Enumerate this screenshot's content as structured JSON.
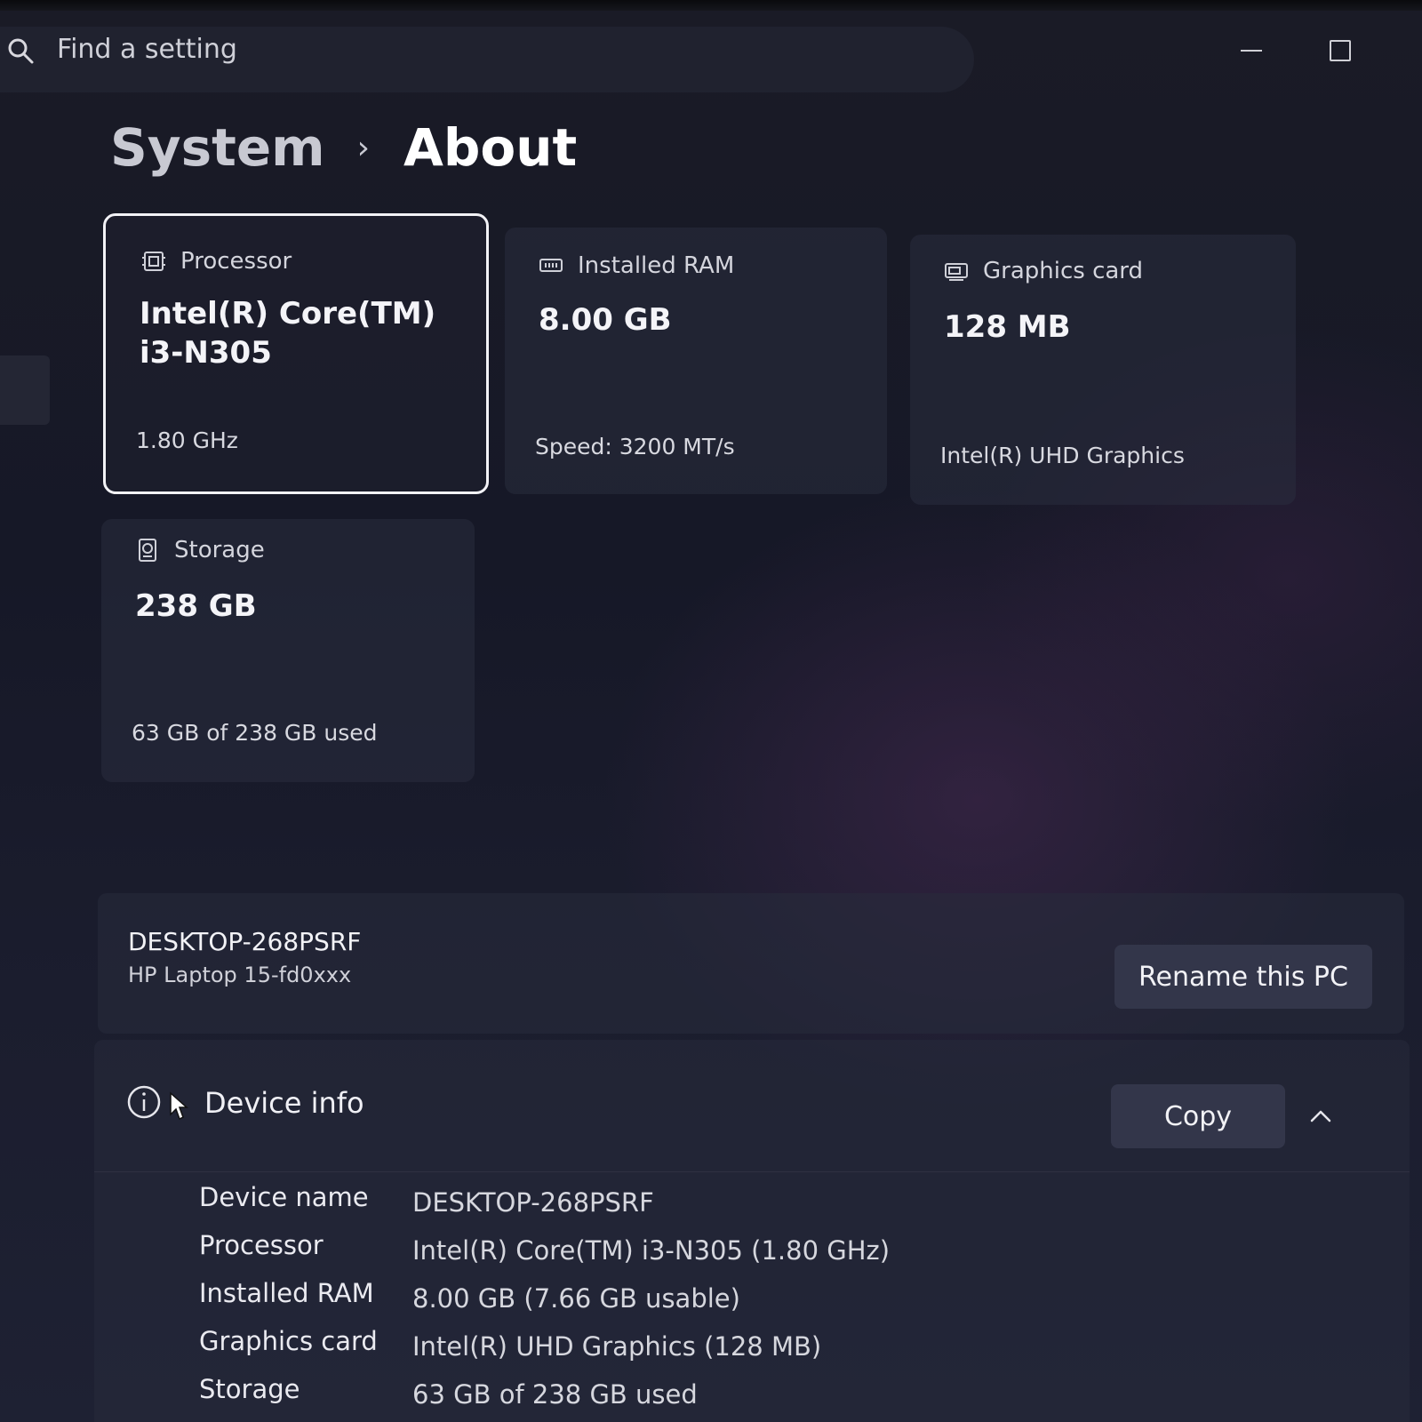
{
  "search": {
    "placeholder": "Find a setting"
  },
  "breadcrumb": {
    "parent": "System",
    "separator": "›",
    "current": "About"
  },
  "spec_cards": [
    {
      "icon": "processor-icon",
      "title": "Processor",
      "value": "Intel(R) Core(TM) i3-N305",
      "sub": "1.80 GHz",
      "selected": true
    },
    {
      "icon": "ram-icon",
      "title": "Installed RAM",
      "value": "8.00 GB",
      "sub": "Speed: 3200 MT/s",
      "selected": false
    },
    {
      "icon": "graphics-card-icon",
      "title": "Graphics card",
      "value": "128 MB",
      "sub": "Intel(R) UHD Graphics",
      "selected": false
    },
    {
      "icon": "storage-icon",
      "title": "Storage",
      "value": "238 GB",
      "sub": "63 GB of 238 GB used",
      "selected": false
    }
  ],
  "pc": {
    "name": "DESKTOP-268PSRF",
    "model": "HP Laptop 15-fd0xxx",
    "rename_label": "Rename this PC"
  },
  "device_info": {
    "title": "Device info",
    "copy_label": "Copy",
    "rows": [
      {
        "label": "Device name",
        "value": "DESKTOP-268PSRF"
      },
      {
        "label": "Processor",
        "value": "Intel(R) Core(TM) i3-N305 (1.80 GHz)"
      },
      {
        "label": "Installed RAM",
        "value": "8.00 GB (7.66 GB usable)"
      },
      {
        "label": "Graphics card",
        "value": "Intel(R) UHD Graphics (128 MB)"
      },
      {
        "label": "Storage",
        "value": "63 GB of 238 GB used"
      }
    ]
  }
}
